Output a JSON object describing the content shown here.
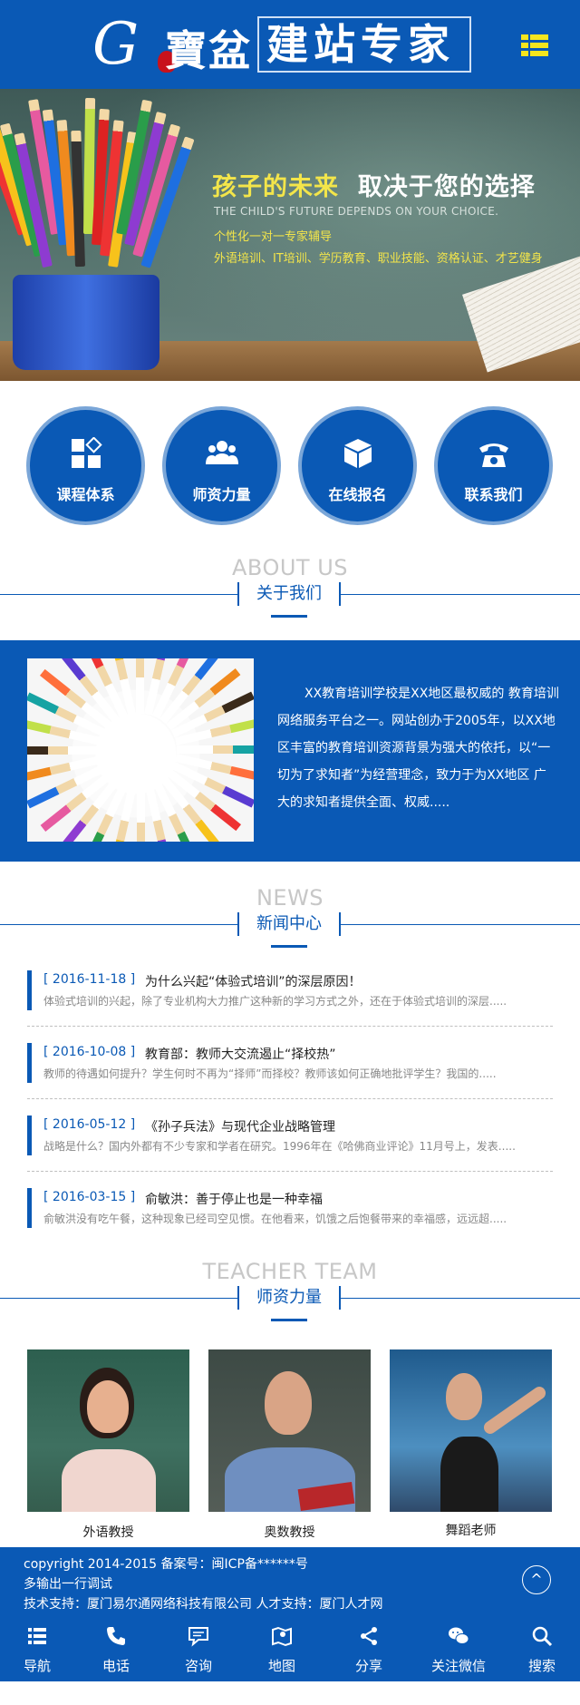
{
  "header": {
    "logo_g": "G",
    "logo_brand": "寶盆",
    "logo_slogan": "建站专家",
    "menu_icon": "hamburger-menu-icon"
  },
  "banner": {
    "title_highlight": "孩子的未来",
    "title_rest": "取决于您的选择",
    "subtitle_en": "THE CHILD'S FUTURE DEPENDS ON YOUR CHOICE.",
    "line1": "个性化一对一专家辅导",
    "line2": "外语培训、IT培训、学历教育、职业技能、资格认证、才艺健身"
  },
  "quick_nav": [
    {
      "label": "课程体系",
      "icon": "grid-diamond-icon"
    },
    {
      "label": "师资力量",
      "icon": "people-group-icon"
    },
    {
      "label": "在线报名",
      "icon": "cube-icon"
    },
    {
      "label": "联系我们",
      "icon": "telephone-icon"
    }
  ],
  "about": {
    "heading_en": "ABOUT US",
    "heading_cn": "关于我们",
    "text": "XX教育培训学校是XX地区最权威的 教育培训网络服务平台之一。网站创办于2005年，以XX地区丰富的教育培训资源背景为强大的依托，以“一切为了求知者”为经营理念，致力于为XX地区 广 大的求知者提供全面、权威....."
  },
  "news": {
    "heading_en": "NEWS",
    "heading_cn": "新闻中心",
    "items": [
      {
        "date": "[ 2016-11-18 ]",
        "title": "为什么兴起“体验式培训”的深层原因！",
        "summary": "体验式培训的兴起，除了专业机构大力推广这种新的学习方式之外，还在于体验式培训的深层....."
      },
      {
        "date": "[ 2016-10-08 ]",
        "title": "教育部：教师大交流遏止“择校热”",
        "summary": "教师的待遇如何提升？学生何时不再为“择师”而择校？教师该如何正确地批评学生？我国的....."
      },
      {
        "date": "[ 2016-05-12 ]",
        "title": "《孙子兵法》与现代企业战略管理",
        "summary": "战略是什么？国内外都有不少专家和学者在研究。1996年在《哈佛商业评论》11月号上，发表....."
      },
      {
        "date": "[ 2016-03-15 ]",
        "title": "俞敏洪：善于停止也是一种幸福",
        "summary": "俞敏洪没有吃午餐，这种现象已经司空见惯。在他看来，饥饿之后饱餐带来的幸福感，远远超....."
      }
    ]
  },
  "teachers": {
    "heading_en": "TEACHER TEAM",
    "heading_cn": "师资力量",
    "items": [
      {
        "name": "外语教授"
      },
      {
        "name": "奥数教授"
      },
      {
        "name": "舞蹈老师"
      }
    ]
  },
  "footer": {
    "line1": "copyright 2014-2015 备案号：闽ICP备******号",
    "line2": "多输出一行调试",
    "line3": "技术支持：厦门易尔通网络科技有限公司 人才支持：厦门人才网",
    "to_top": "^"
  },
  "bottom_nav": [
    {
      "label": "导航",
      "icon": "list-icon"
    },
    {
      "label": "电话",
      "icon": "phone-icon"
    },
    {
      "label": "咨询",
      "icon": "chat-icon"
    },
    {
      "label": "地图",
      "icon": "map-icon"
    },
    {
      "label": "分享",
      "icon": "share-icon"
    },
    {
      "label": "关注微信",
      "icon": "wechat-icon"
    },
    {
      "label": "搜索",
      "icon": "search-icon"
    }
  ],
  "colors": {
    "primary": "#0a59b5",
    "banner_highlight": "#f3e54a",
    "heading_en_gray": "#c7c7c7"
  }
}
